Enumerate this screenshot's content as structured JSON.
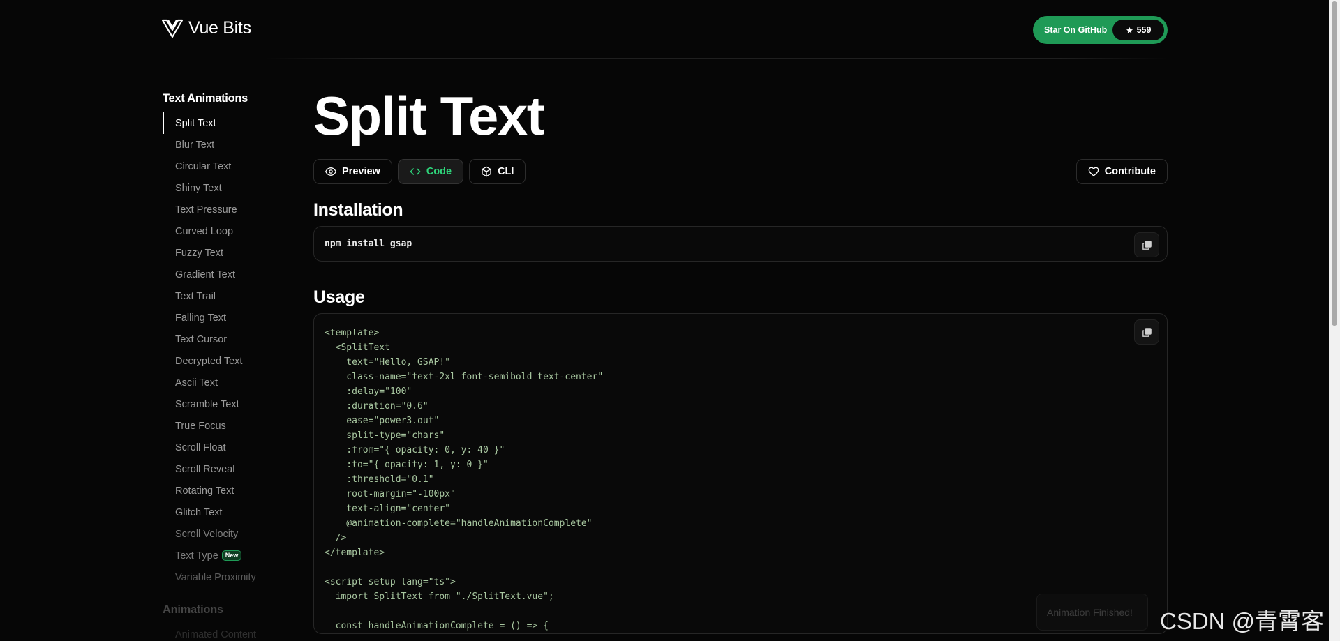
{
  "header": {
    "logo_text": "Vue Bits",
    "github_label": "Star On GitHub",
    "github_stars": "559",
    "accent": "#1f9a56"
  },
  "sidebar": {
    "categories": [
      {
        "title": "Text Animations",
        "items": [
          {
            "label": "Split Text",
            "active": true
          },
          {
            "label": "Blur Text"
          },
          {
            "label": "Circular Text"
          },
          {
            "label": "Shiny Text"
          },
          {
            "label": "Text Pressure"
          },
          {
            "label": "Curved Loop"
          },
          {
            "label": "Fuzzy Text"
          },
          {
            "label": "Gradient Text"
          },
          {
            "label": "Text Trail"
          },
          {
            "label": "Falling Text"
          },
          {
            "label": "Text Cursor"
          },
          {
            "label": "Decrypted Text"
          },
          {
            "label": "Ascii Text"
          },
          {
            "label": "Scramble Text"
          },
          {
            "label": "True Focus"
          },
          {
            "label": "Scroll Float"
          },
          {
            "label": "Scroll Reveal"
          },
          {
            "label": "Rotating Text"
          },
          {
            "label": "Glitch Text"
          },
          {
            "label": "Scroll Velocity"
          },
          {
            "label": "Text Type",
            "badge": "New"
          },
          {
            "label": "Variable Proximity"
          }
        ]
      },
      {
        "title": "Animations",
        "items": [
          {
            "label": "Animated Content"
          }
        ]
      }
    ]
  },
  "main": {
    "title": "Split Text",
    "tabs": {
      "preview": "Preview",
      "code": "Code",
      "cli": "CLI",
      "contribute": "Contribute",
      "active": "code"
    },
    "installation": {
      "heading": "Installation",
      "command": "npm install gsap"
    },
    "usage": {
      "heading": "Usage",
      "lines": [
        "<template>",
        "  <SplitText",
        "    text=\"Hello, GSAP!\"",
        "    class-name=\"text-2xl font-semibold text-center\"",
        "    :delay=\"100\"",
        "    :duration=\"0.6\"",
        "    ease=\"power3.out\"",
        "    split-type=\"chars\"",
        "    :from=\"{ opacity: 0, y: 40 }\"",
        "    :to=\"{ opacity: 1, y: 0 }\"",
        "    :threshold=\"0.1\"",
        "    root-margin=\"-100px\"",
        "    text-align=\"center\"",
        "    @animation-complete=\"handleAnimationComplete\"",
        "  />",
        "</template>",
        "",
        "<script setup lang=\"ts\">",
        "  import SplitText from \"./SplitText.vue\";",
        "",
        "  const handleAnimationComplete = () => {"
      ]
    }
  },
  "toast": "Animation Finished!",
  "watermark": "CSDN @青霄客"
}
